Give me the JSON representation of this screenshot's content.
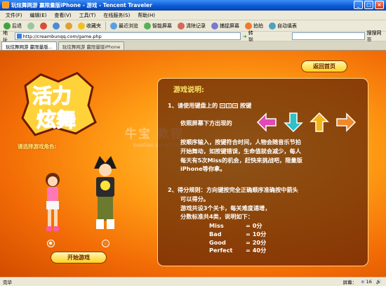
{
  "window": {
    "title": "玩炫舞网游 赢限量版iPhone - 游戏 - Tencent Traveler"
  },
  "menu": [
    "文件(F)",
    "编辑(E)",
    "查看(V)",
    "工具(T)",
    "在线服务(S)",
    "帮助(H)"
  ],
  "toolbar": {
    "back": "后退",
    "favorites": "收藏夹",
    "recent": "最近浏览",
    "smart_screen": "智能屏幕",
    "clear_history": "清除记录",
    "capture": "捕捉屏幕",
    "snapshot": "拍拍",
    "autofill": "自动填表"
  },
  "address": {
    "label": "地址",
    "url": "http://creambunqq.com/game.php",
    "go": "转到",
    "search_placeholder": "",
    "search_btn": "搜搜网页"
  },
  "tabs": [
    "玩炫舞网游 赢限量版...",
    "玩炫舞网游 赢限量版iPhone"
  ],
  "game": {
    "logo_text": "活力炫舞",
    "choose_label": "请选择游戏角色:",
    "start_button": "开始游戏",
    "back_button": "返回首页",
    "panel_title": "游戏说明:",
    "line1": "1、请使用键盘上的",
    "line1b": "按键",
    "line2": "依照屏幕下方出现的",
    "para1": [
      "按顺序输入，按键符合时间，人物会随音乐节拍",
      "开始舞动，如按键错误，生命值就会减少，每人",
      "每天有5次Miss的机会，赶快来挑战吧，限量版",
      "iPhone等你拿。"
    ],
    "para2": [
      "2、得分规则：方向键按完全正确顺序准确按中箭头",
      "可以得分。",
      "游戏共设3个关卡，每关难度递增，",
      "分数标准共4类，说明如下："
    ],
    "scores": [
      {
        "name": "Miss",
        "value": "= 0分"
      },
      {
        "name": "Bad",
        "value": "= 10分"
      },
      {
        "name": "Good",
        "value": "= 20分"
      },
      {
        "name": "Perfect",
        "value": "= 40分"
      }
    ],
    "arrow_colors": [
      "#e04ab5",
      "#2ec1c9",
      "#f3b41a",
      "#f08a2a"
    ],
    "watermark": "牛宝 教程",
    "watermark_url": "baoliao.xxxx.com"
  },
  "status": {
    "left": "完毕",
    "screen": "屏幕：",
    "zoom": "16"
  }
}
